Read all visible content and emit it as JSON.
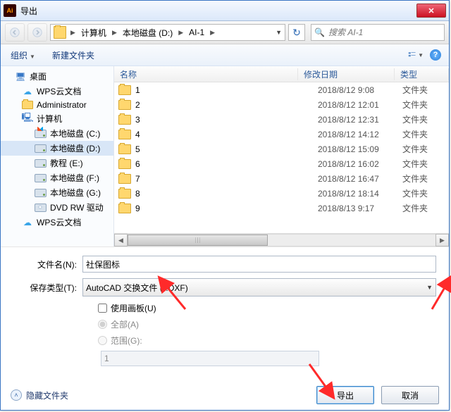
{
  "title": "导出",
  "breadcrumb": {
    "items": [
      "计算机",
      "本地磁盘 (D:)",
      "AI-1"
    ]
  },
  "search_placeholder": "搜索 AI-1",
  "toolbar": {
    "organize": "组织",
    "newfolder": "新建文件夹"
  },
  "sidebar": {
    "desktop": "桌面",
    "wps_cloud": "WPS云文档",
    "admin": "Administrator",
    "computer": "计算机",
    "c": "本地磁盘 (C:)",
    "d": "本地磁盘 (D:)",
    "e": "教程 (E:)",
    "f": "本地磁盘 (F:)",
    "g": "本地磁盘 (G:)",
    "dvd": "DVD RW 驱动",
    "wps2": "WPS云文档"
  },
  "columns": {
    "name": "名称",
    "date": "修改日期",
    "type": "类型"
  },
  "files": [
    {
      "name": "1",
      "date": "2018/8/12 9:08",
      "type": "文件夹"
    },
    {
      "name": "2",
      "date": "2018/8/12 12:01",
      "type": "文件夹"
    },
    {
      "name": "3",
      "date": "2018/8/12 12:31",
      "type": "文件夹"
    },
    {
      "name": "4",
      "date": "2018/8/12 14:12",
      "type": "文件夹"
    },
    {
      "name": "5",
      "date": "2018/8/12 15:09",
      "type": "文件夹"
    },
    {
      "name": "6",
      "date": "2018/8/12 16:02",
      "type": "文件夹"
    },
    {
      "name": "7",
      "date": "2018/8/12 16:47",
      "type": "文件夹"
    },
    {
      "name": "8",
      "date": "2018/8/12 18:14",
      "type": "文件夹"
    },
    {
      "name": "9",
      "date": "2018/8/13 9:17",
      "type": "文件夹"
    }
  ],
  "form": {
    "filename_label": "文件名(N):",
    "filename_value": "社保图标",
    "savetype_label": "保存类型(T):",
    "savetype_value": "AutoCAD 交换文件 (*.DXF)",
    "use_artboard": "使用画板(U)",
    "all": "全部(A)",
    "range": "范围(G):",
    "range_value": "1"
  },
  "footer": {
    "hide": "隐藏文件夹",
    "export": "导出",
    "cancel": "取消"
  }
}
